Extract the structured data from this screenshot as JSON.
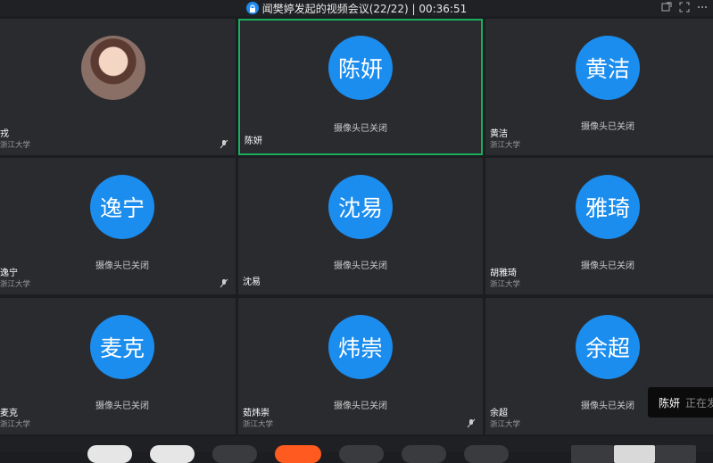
{
  "title": "闻樊婷发起的视频会议(22/22) | 00:36:51",
  "camera_off": "摄像头已关闭",
  "tiles": [
    {
      "name": "戎",
      "org": "浙江大学",
      "avatar": "",
      "photo": true
    },
    {
      "name": "陈妍",
      "org": "",
      "avatar": "陈妍"
    },
    {
      "name": "黄洁",
      "org": "浙江大学",
      "avatar": "黄洁"
    },
    {
      "name": "黄逸宁",
      "org": "浙江大学",
      "avatar": "逸宁"
    },
    {
      "name": "沈易",
      "org": "",
      "avatar": "沈易"
    },
    {
      "name": "胡雅琦",
      "org": "浙江大学",
      "avatar": "雅琦"
    },
    {
      "name": "王麦克",
      "org": "浙江大学",
      "avatar": "麦克"
    },
    {
      "name": "茹炜崇",
      "org": "浙江大学",
      "avatar": "炜崇"
    },
    {
      "name": "余超",
      "org": "浙江大学",
      "avatar": "余超"
    }
  ],
  "toast": {
    "name": "陈妍",
    "text": "正在发"
  },
  "colors": {
    "accent": "#1b8dee",
    "active_border": "#1aad5e",
    "bg": "#1c1d20",
    "tile": "#2a2b2f"
  }
}
